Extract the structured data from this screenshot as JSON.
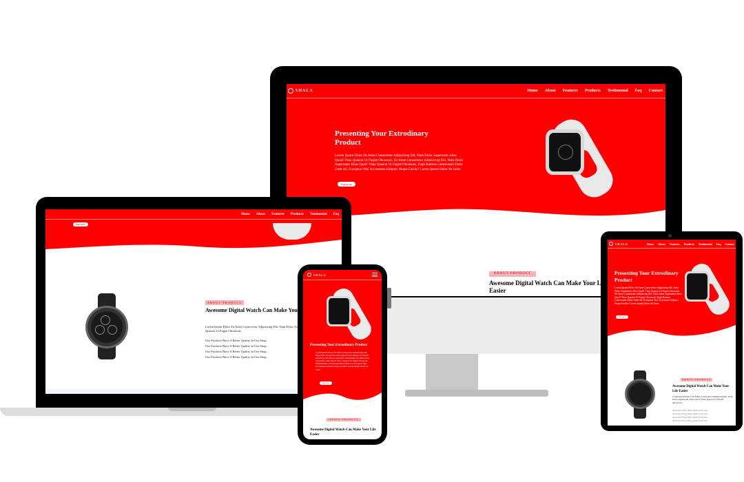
{
  "brand": "SHALA",
  "nav_links": [
    "Home",
    "About",
    "Features",
    "Products",
    "Testimonial",
    "Faq",
    "Contact"
  ],
  "hero": {
    "title": "Presenting Your Extrodinary Product",
    "text": "Lorem Ipsum Dolor Sit Amet Consectetur Adipisicing Elit. Nam Dolor Aspernatur Alias Quod! Vitae Quaerat Ut Fugiat Obcaecati. Sit Amet Consectetur Adipisicing Elit. Nam Dolor Aspernatur Alias Quod! Vitae Quaerat Ut Fugiat Obcaecati, Fugit Ratione Laboriosam Dolor Unde Ad, Excepturi Nisi Accusamus Adipisci Neque Facilis? Lorem Ipsum Dolor Sit Amet",
    "button": "buy now"
  },
  "about": {
    "badge": "ABOUT PRODUCT",
    "title": "Awesome Digital Watch Can Make Your Life Easier",
    "text": "Lorem Ipsum Dolor Sit Amet Consectetur Adipisicing Elit. Nam Dolor Aspernatur Alias Quod! Vitae Quaerat Ut Fugiat Obcaecati.",
    "points": [
      "Our Products Have A Better Quality In Our Shop.",
      "Our Products Have A Better Quality In Our Shop.",
      "Our Products Have A Better Quality In Our Shop.",
      "Our Products Have A Better Quality In Our Shop."
    ]
  },
  "colors": {
    "primary": "#ff0000",
    "badge_bg": "#f8b4b4",
    "device_black": "#000000",
    "stand_gray": "#c8c8c8"
  }
}
